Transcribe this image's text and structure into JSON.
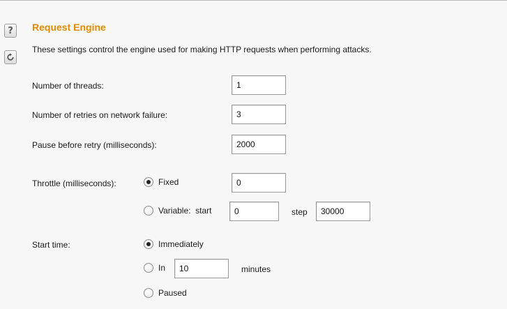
{
  "section": {
    "title": "Request Engine",
    "description": "These settings control the engine used for making HTTP requests when performing attacks.",
    "help_icon": "question-mark-icon",
    "reset_icon": "refresh-icon",
    "accent_color": "#e58a00"
  },
  "threads": {
    "label": "Number of threads:",
    "value": "1"
  },
  "retries": {
    "label": "Number of retries on network failure:",
    "value": "3"
  },
  "pause": {
    "label": "Pause before retry (milliseconds):",
    "value": "2000"
  },
  "throttle": {
    "label": "Throttle (milliseconds):",
    "fixed_label": "Fixed",
    "fixed_checked": true,
    "fixed_value": "0",
    "variable_label": "Variable:  start",
    "variable_checked": false,
    "start_value": "0",
    "step_label": "step",
    "step_value": "30000"
  },
  "start_time": {
    "label": "Start time:",
    "immediately_label": "Immediately",
    "immediately_checked": true,
    "in_label": "In",
    "in_checked": false,
    "in_value": "10",
    "minutes_label": "minutes",
    "paused_label": "Paused",
    "paused_checked": false
  }
}
